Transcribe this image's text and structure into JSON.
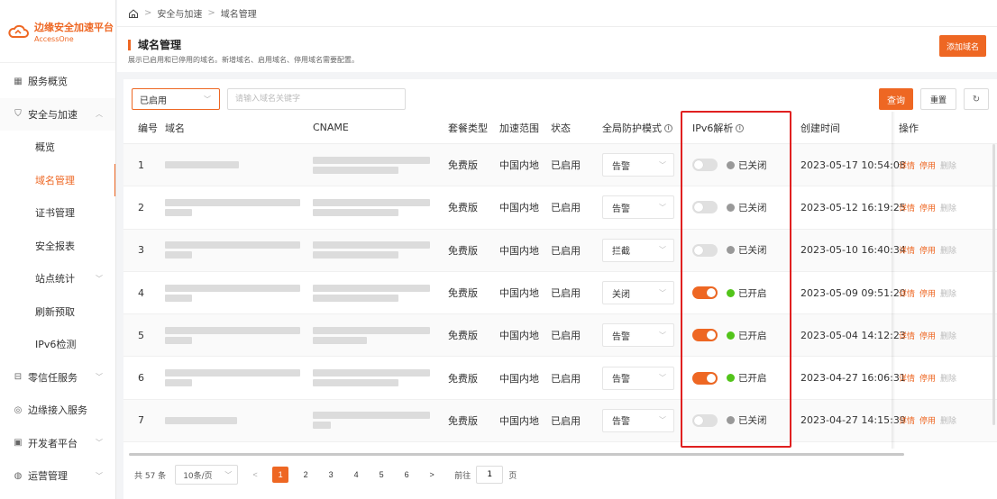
{
  "brand": {
    "name": "边缘安全加速平台",
    "sub": "AccessOne",
    "color": "#ee6723"
  },
  "breadcrumb": [
    "安全与加速",
    "域名管理"
  ],
  "header": {
    "title": "域名管理",
    "desc": "展示已启用和已停用的域名。新增域名、启用域名、停用域名需要配置。",
    "add_label": "添加域名"
  },
  "sidebar": {
    "items": [
      {
        "label": "服务概览",
        "icon": "grid-icon"
      },
      {
        "label": "安全与加速",
        "icon": "shield-icon",
        "chev": "︿"
      },
      {
        "label": "概览"
      },
      {
        "label": "域名管理",
        "active": true
      },
      {
        "label": "证书管理"
      },
      {
        "label": "安全报表"
      },
      {
        "label": "站点统计",
        "chev": "﹀"
      },
      {
        "label": "刷新预取"
      },
      {
        "label": "IPv6检测"
      },
      {
        "label": "零信任服务",
        "icon": "zero-trust-icon",
        "chev": "﹀"
      },
      {
        "label": "边缘接入服务",
        "icon": "edge-icon"
      },
      {
        "label": "开发者平台",
        "icon": "dev-icon",
        "chev": "﹀"
      },
      {
        "label": "运营管理",
        "icon": "ops-icon",
        "chev": "﹀"
      }
    ]
  },
  "filters": {
    "status_value": "已启用",
    "search_placeholder": "请输入域名关键字",
    "query_label": "查询",
    "reset_label": "重置",
    "refresh_icon": "↻"
  },
  "table": {
    "columns": {
      "id": "编号",
      "domain": "域名",
      "cname": "CNAME",
      "plan": "套餐类型",
      "range": "加速范围",
      "status": "状态",
      "mode": "全局防护模式",
      "ipv6": "IPv6解析",
      "time": "创建时间",
      "ops": "操作"
    },
    "rows": [
      {
        "id": "1",
        "plan": "免费版",
        "range": "中国内地",
        "status": "已启用",
        "mode": "告警",
        "ipv6_on": false,
        "ipv6_text": "已关闭",
        "time": "2023-05-17 10:54:08"
      },
      {
        "id": "2",
        "plan": "免费版",
        "range": "中国内地",
        "status": "已启用",
        "mode": "告警",
        "ipv6_on": false,
        "ipv6_text": "已关闭",
        "time": "2023-05-12 16:19:25"
      },
      {
        "id": "3",
        "plan": "免费版",
        "range": "中国内地",
        "status": "已启用",
        "mode": "拦截",
        "ipv6_on": false,
        "ipv6_text": "已关闭",
        "time": "2023-05-10 16:40:34"
      },
      {
        "id": "4",
        "plan": "免费版",
        "range": "中国内地",
        "status": "已启用",
        "mode": "关闭",
        "ipv6_on": true,
        "ipv6_text": "已开启",
        "time": "2023-05-09 09:51:20"
      },
      {
        "id": "5",
        "plan": "免费版",
        "range": "中国内地",
        "status": "已启用",
        "mode": "告警",
        "ipv6_on": true,
        "ipv6_text": "已开启",
        "time": "2023-05-04 14:12:23"
      },
      {
        "id": "6",
        "plan": "免费版",
        "range": "中国内地",
        "status": "已启用",
        "mode": "告警",
        "ipv6_on": true,
        "ipv6_text": "已开启",
        "time": "2023-04-27 16:06:31"
      },
      {
        "id": "7",
        "plan": "免费版",
        "range": "中国内地",
        "status": "已启用",
        "mode": "告警",
        "ipv6_on": false,
        "ipv6_text": "已关闭",
        "time": "2023-04-27 14:15:39"
      }
    ],
    "ops": {
      "detail": "详情",
      "disable": "停用",
      "delete": "删除"
    }
  },
  "pagination": {
    "total": "共 57 条",
    "page_size": "10条/页",
    "pages": [
      "1",
      "2",
      "3",
      "4",
      "5",
      "6"
    ],
    "current": "1",
    "goto_prefix": "前往",
    "goto_value": "1",
    "goto_suffix": "页"
  }
}
